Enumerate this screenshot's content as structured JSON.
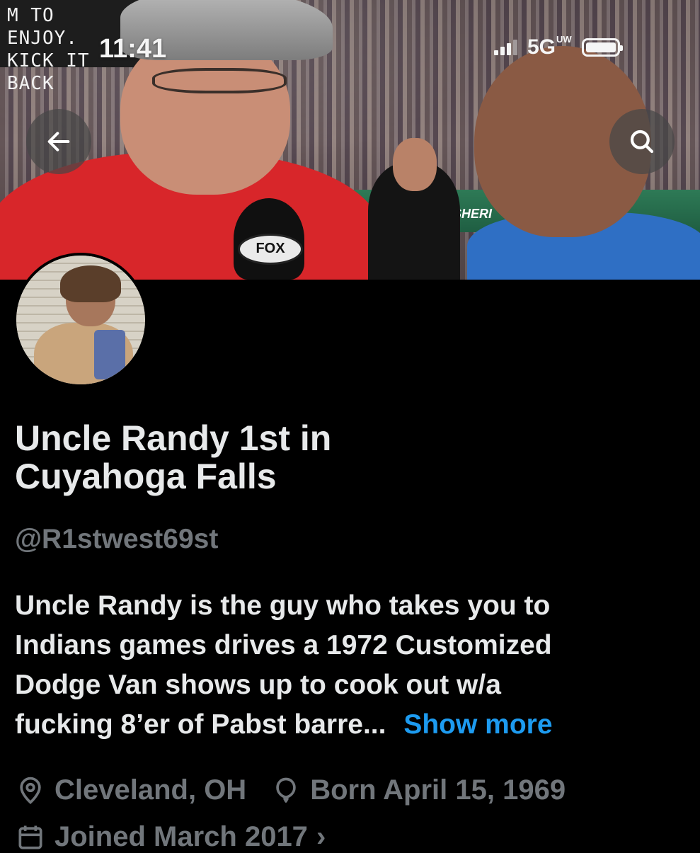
{
  "status_bar": {
    "time": "11:41",
    "network": "5G",
    "network_suffix": "UW"
  },
  "banner": {
    "sign_line1": "M TO ENJOY.",
    "sign_line2": "KICK IT BACK",
    "wall_text": "SHERI",
    "mic_flag": "FOX"
  },
  "nav": {
    "back_icon": "arrow-left-icon",
    "search_icon": "search-icon"
  },
  "profile": {
    "display_name_line1": "Uncle Randy 1st in",
    "display_name_line2": "Cuyahoga Falls",
    "handle": "@R1stwest69st",
    "bio_line1": "Uncle Randy is the guy who takes you to",
    "bio_line2": "Indians games drives a 1972 Customized",
    "bio_line3": "Dodge Van shows up to cook out w/a",
    "bio_line4": "fucking 8’er of Pabst barre...",
    "show_more": "Show more",
    "location": "Cleveland, OH",
    "birthday": "Born April 15, 1969",
    "joined": "Joined March 2017",
    "joined_chevron": "›"
  },
  "colors": {
    "background": "#000000",
    "primary_text": "#e7e9ea",
    "secondary_text": "#71767b",
    "link": "#1d9bf0"
  }
}
